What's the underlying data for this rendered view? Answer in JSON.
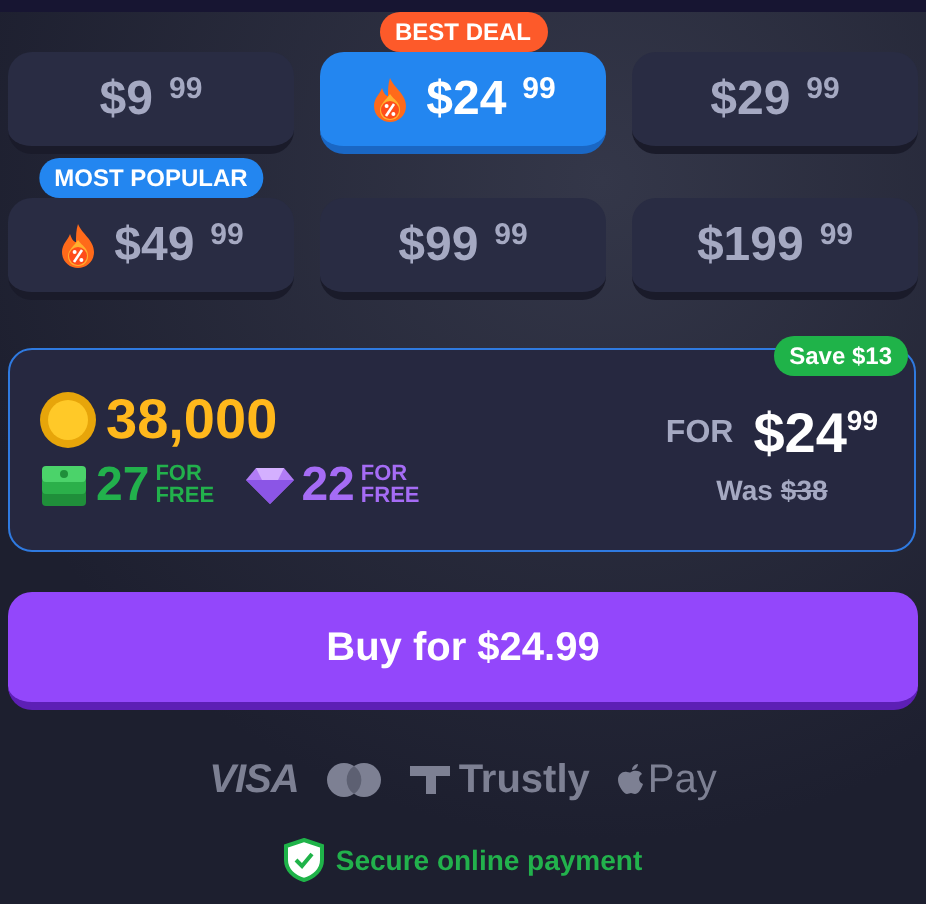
{
  "packages": [
    {
      "price": "$9",
      "cents": "99",
      "selected": false,
      "fire": false
    },
    {
      "price": "$24",
      "cents": "99",
      "selected": true,
      "fire": true,
      "badge": {
        "text": "BEST DEAL",
        "color": "#fd5a2a"
      }
    },
    {
      "price": "$29",
      "cents": "99",
      "selected": false,
      "fire": false
    },
    {
      "price": "$49",
      "cents": "99",
      "selected": false,
      "fire": true,
      "badge": {
        "text": "MOST POPULAR",
        "color": "#2386f0"
      }
    },
    {
      "price": "$99",
      "cents": "99",
      "selected": false,
      "fire": false
    },
    {
      "price": "$199",
      "cents": "99",
      "selected": false,
      "fire": false
    }
  ],
  "offer": {
    "save": "Save $13",
    "coins": "38,000",
    "bonuses": [
      {
        "kind": "cash",
        "amount": "27",
        "label": "FOR FREE"
      },
      {
        "kind": "gem",
        "amount": "22",
        "label": "FOR FREE"
      }
    ],
    "for_label": "FOR",
    "price": "$24",
    "cents": "99",
    "was_label": "Was",
    "was_price": "$38"
  },
  "buy_button": "Buy for $24.99",
  "payment_methods": [
    {
      "kind": "visa",
      "text": "VISA"
    },
    {
      "kind": "mastercard"
    },
    {
      "kind": "trustly",
      "text": "Trustly"
    },
    {
      "kind": "applepay",
      "text": "Pay"
    }
  ],
  "secure": "Secure online payment"
}
